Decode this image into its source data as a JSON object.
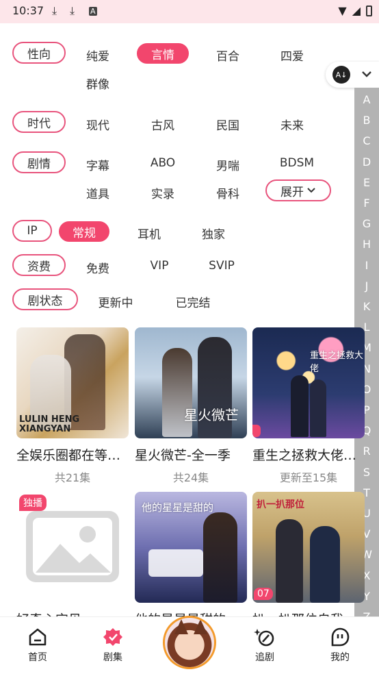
{
  "status_bar": {
    "time": "10:37"
  },
  "filters": {
    "xingxiang": {
      "label": "性向",
      "options": [
        "纯爱",
        "言情",
        "百合",
        "四爱",
        "群像"
      ],
      "selected": "言情"
    },
    "shidai": {
      "label": "时代",
      "options": [
        "现代",
        "古风",
        "民国",
        "未来"
      ]
    },
    "juqing": {
      "label": "剧情",
      "options": [
        "字幕",
        "ABO",
        "男喘",
        "BDSM",
        "道具",
        "实录",
        "骨科"
      ],
      "expand": "展开"
    },
    "ip": {
      "label": "IP",
      "options": [
        "常规",
        "耳机",
        "独家"
      ],
      "selected": "常规"
    },
    "zifei": {
      "label": "资费",
      "options": [
        "免费",
        "VIP",
        "SVIP"
      ]
    },
    "juzhuangtai": {
      "label": "剧状态",
      "options": [
        "更新中",
        "已完结"
      ]
    }
  },
  "sort_button": {
    "icon": "sort-az-icon"
  },
  "alphabet": [
    "A",
    "B",
    "C",
    "D",
    "E",
    "F",
    "G",
    "H",
    "I",
    "J",
    "K",
    "L",
    "M",
    "N",
    "O",
    "P",
    "Q",
    "R",
    "S",
    "T",
    "U",
    "V",
    "W",
    "X",
    "Y",
    "Z"
  ],
  "cards": [
    {
      "title": "全娱乐圈都在等…",
      "sub": "共21集",
      "cover_text": "LULIN HENG XIANGYAN"
    },
    {
      "title": "星火微芒-全一季",
      "sub": "共24集",
      "cover_text": "星火微芒"
    },
    {
      "title": "重生之拯救大佬…",
      "sub": "更新至15集",
      "cover_text": "重生之拯救大佬"
    },
    {
      "title": "好奇心宝贝",
      "badge": "独播"
    },
    {
      "title": "他的星星是甜的",
      "cover_text": "他的星星是甜的"
    },
    {
      "title": "扒一扒那位自我…",
      "badge": "07",
      "cover_text": "扒一扒那位"
    }
  ],
  "nav": [
    {
      "label": "首页",
      "icon": "home-icon"
    },
    {
      "label": "剧集",
      "icon": "drama-icon"
    },
    {
      "label": "",
      "icon": "avatar"
    },
    {
      "label": "追剧",
      "icon": "follow-icon"
    },
    {
      "label": "我的",
      "icon": "profile-icon"
    }
  ]
}
